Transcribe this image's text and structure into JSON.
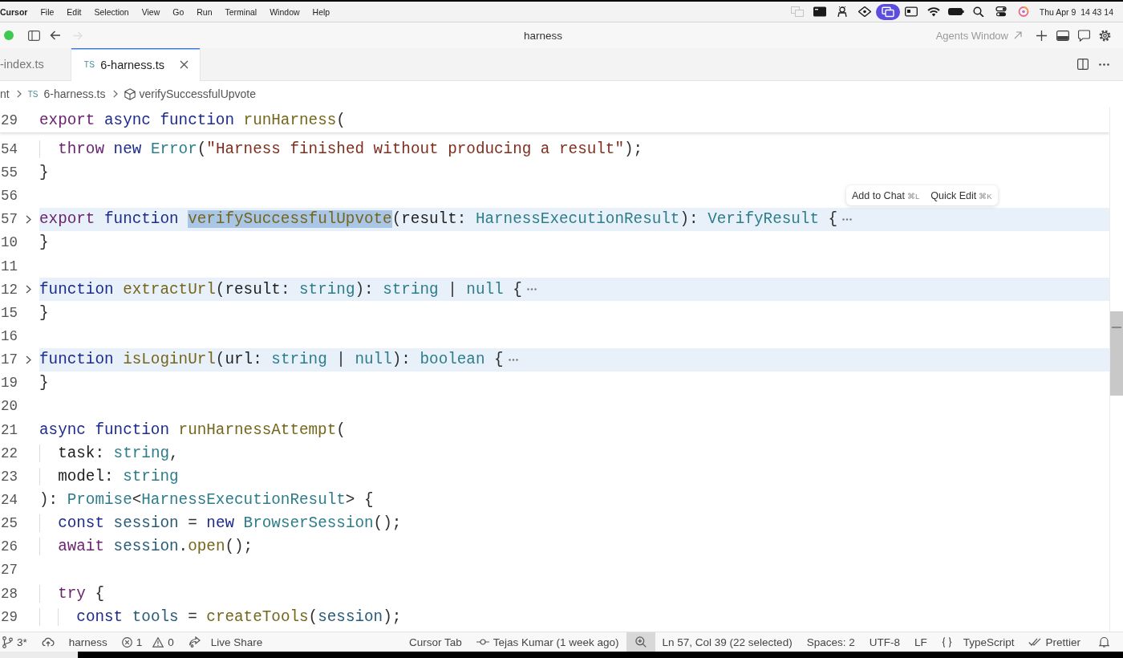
{
  "menu_bar": {
    "app": "Cursor",
    "items": [
      "File",
      "Edit",
      "Selection",
      "View",
      "Go",
      "Run",
      "Terminal",
      "Window",
      "Help"
    ],
    "tray_icons": [
      {
        "active": false
      },
      {
        "active": false
      },
      {
        "active": false
      },
      {
        "active": false
      },
      {
        "active": true
      },
      {
        "active": false
      },
      {
        "active": false
      },
      {
        "active": false
      },
      {
        "active": false
      },
      {
        "active": false
      },
      {
        "active": false
      }
    ],
    "clock": "Thu Apr 9  14 43 14"
  },
  "title_bar": {
    "title": "harness",
    "agents_link": "Agents Window"
  },
  "tabs": [
    {
      "label": "-index.ts",
      "selected": false
    },
    {
      "badge": "TS",
      "label": "6-harness.ts",
      "selected": true
    }
  ],
  "breadcrumbs": [
    {
      "kind": "folder",
      "label": "nt"
    },
    {
      "kind": "file",
      "badge": "TS",
      "label": "6-harness.ts"
    },
    {
      "kind": "symbol",
      "label": "verifySuccessfulUpvote"
    }
  ],
  "editor": {
    "sticky_line": {
      "number": "29",
      "tokens": [
        {
          "kind": "control",
          "text": "export "
        },
        {
          "kind": "keyword",
          "text": "async function "
        },
        {
          "kind": "function",
          "text": "runHarness"
        },
        {
          "kind": "plain",
          "text": "("
        }
      ]
    },
    "lines": [
      {
        "number": "54",
        "folded": false,
        "tokens": [
          {
            "kind": "control",
            "text": "  throw "
          },
          {
            "kind": "keyword",
            "text": "new "
          },
          {
            "kind": "type",
            "text": "Error"
          },
          {
            "kind": "plain",
            "text": "("
          },
          {
            "kind": "string",
            "text": "\"Harness finished without producing a result\""
          },
          {
            "kind": "plain",
            "text": ");"
          }
        ]
      },
      {
        "number": "55",
        "folded": false,
        "tokens": [
          {
            "kind": "plain",
            "text": "}"
          }
        ]
      },
      {
        "number": "56",
        "folded": false
      },
      {
        "number": "57",
        "folded": true,
        "tokens": [
          {
            "kind": "control",
            "text": "export "
          },
          {
            "kind": "keyword",
            "text": "function "
          },
          {
            "kind": "function",
            "text": "verifySuccessfulUpvote",
            "selected": true
          },
          {
            "kind": "plain",
            "text": "("
          },
          {
            "kind": "param",
            "text": "result"
          },
          {
            "kind": "plain",
            "text": ": "
          },
          {
            "kind": "type",
            "text": "HarnessExecutionResult"
          },
          {
            "kind": "plain",
            "text": "): "
          },
          {
            "kind": "type",
            "text": "VerifyResult"
          },
          {
            "kind": "plain",
            "text": " {"
          }
        ]
      },
      {
        "number": "10",
        "folded": false,
        "tokens": [
          {
            "kind": "plain",
            "text": "}"
          }
        ]
      },
      {
        "number": "11",
        "folded": false
      },
      {
        "number": "12",
        "folded": true,
        "tokens": [
          {
            "kind": "keyword",
            "text": "function "
          },
          {
            "kind": "function",
            "text": "extractUrl"
          },
          {
            "kind": "plain",
            "text": "("
          },
          {
            "kind": "param",
            "text": "result"
          },
          {
            "kind": "plain",
            "text": ": "
          },
          {
            "kind": "type",
            "text": "string"
          },
          {
            "kind": "plain",
            "text": "): "
          },
          {
            "kind": "type",
            "text": "string"
          },
          {
            "kind": "plain",
            "text": " | "
          },
          {
            "kind": "type",
            "text": "null"
          },
          {
            "kind": "plain",
            "text": " {"
          }
        ]
      },
      {
        "number": "15",
        "folded": false,
        "tokens": [
          {
            "kind": "plain",
            "text": "}"
          }
        ]
      },
      {
        "number": "16",
        "folded": false
      },
      {
        "number": "17",
        "folded": true,
        "tokens": [
          {
            "kind": "keyword",
            "text": "function "
          },
          {
            "kind": "function",
            "text": "isLoginUrl"
          },
          {
            "kind": "plain",
            "text": "("
          },
          {
            "kind": "param",
            "text": "url"
          },
          {
            "kind": "plain",
            "text": ": "
          },
          {
            "kind": "type",
            "text": "string"
          },
          {
            "kind": "plain",
            "text": " | "
          },
          {
            "kind": "type",
            "text": "null"
          },
          {
            "kind": "plain",
            "text": "): "
          },
          {
            "kind": "type",
            "text": "boolean"
          },
          {
            "kind": "plain",
            "text": " {"
          }
        ]
      },
      {
        "number": "19",
        "folded": false,
        "tokens": [
          {
            "kind": "plain",
            "text": "}"
          }
        ]
      },
      {
        "number": "20",
        "folded": false
      },
      {
        "number": "21",
        "folded": false,
        "tokens": [
          {
            "kind": "keyword",
            "text": "async function "
          },
          {
            "kind": "function",
            "text": "runHarnessAttempt"
          },
          {
            "kind": "plain",
            "text": "("
          }
        ]
      },
      {
        "number": "22",
        "folded": false,
        "tokens": [
          {
            "kind": "param",
            "text": "  task"
          },
          {
            "kind": "plain",
            "text": ": "
          },
          {
            "kind": "type",
            "text": "string"
          },
          {
            "kind": "plain",
            "text": ","
          }
        ]
      },
      {
        "number": "23",
        "folded": false,
        "tokens": [
          {
            "kind": "param",
            "text": "  model"
          },
          {
            "kind": "plain",
            "text": ": "
          },
          {
            "kind": "type",
            "text": "string"
          }
        ]
      },
      {
        "number": "24",
        "folded": false,
        "tokens": [
          {
            "kind": "plain",
            "text": "): "
          },
          {
            "kind": "type",
            "text": "Promise"
          },
          {
            "kind": "plain",
            "text": "<"
          },
          {
            "kind": "type",
            "text": "HarnessExecutionResult"
          },
          {
            "kind": "plain",
            "text": "> {"
          }
        ]
      },
      {
        "number": "25",
        "folded": false,
        "tokens": [
          {
            "kind": "keyword",
            "text": "  const "
          },
          {
            "kind": "variable",
            "text": "session"
          },
          {
            "kind": "plain",
            "text": " = "
          },
          {
            "kind": "keyword",
            "text": "new "
          },
          {
            "kind": "type",
            "text": "BrowserSession"
          },
          {
            "kind": "plain",
            "text": "();"
          }
        ]
      },
      {
        "number": "26",
        "folded": false,
        "tokens": [
          {
            "kind": "control",
            "text": "  await "
          },
          {
            "kind": "variable",
            "text": "session"
          },
          {
            "kind": "plain",
            "text": "."
          },
          {
            "kind": "function",
            "text": "open"
          },
          {
            "kind": "plain",
            "text": "();"
          }
        ]
      },
      {
        "number": "27",
        "folded": false
      },
      {
        "number": "28",
        "folded": false,
        "tokens": [
          {
            "kind": "control",
            "text": "  try "
          },
          {
            "kind": "plain",
            "text": "{"
          }
        ]
      },
      {
        "number": "29",
        "folded": false,
        "tokens": [
          {
            "kind": "keyword",
            "text": "    const "
          },
          {
            "kind": "variable",
            "text": "tools"
          },
          {
            "kind": "plain",
            "text": " = "
          },
          {
            "kind": "function",
            "text": "createTools"
          },
          {
            "kind": "plain",
            "text": "("
          },
          {
            "kind": "variable",
            "text": "session"
          },
          {
            "kind": "plain",
            "text": ");"
          }
        ]
      }
    ],
    "selection_toolbar": [
      {
        "label": "Add to Chat",
        "shortcut": "⌘L"
      },
      {
        "label": "Quick Edit",
        "shortcut": "⌘K"
      }
    ]
  },
  "status_bar": {
    "left": [
      {
        "kind": "branch",
        "text": "3*"
      },
      {
        "kind": "publish"
      },
      {
        "kind": "label",
        "text": "harness"
      },
      {
        "kind": "problems",
        "errors": "1",
        "warnings": "0"
      },
      {
        "kind": "live_share",
        "text": "Live Share"
      }
    ],
    "right": [
      {
        "kind": "label",
        "text": "Cursor Tab"
      },
      {
        "kind": "blame",
        "text": "Tejas Kumar (1 week ago)"
      },
      {
        "kind": "zoom",
        "highlighted": true
      },
      {
        "kind": "label",
        "text": "Ln 57, Col 39 (22 selected)"
      },
      {
        "kind": "label",
        "text": "Spaces: 2"
      },
      {
        "kind": "label",
        "text": "UTF-8"
      },
      {
        "kind": "label",
        "text": "LF"
      },
      {
        "kind": "language",
        "text": "TypeScript"
      },
      {
        "kind": "formatter",
        "text": "Prettier"
      },
      {
        "kind": "notifications"
      }
    ]
  }
}
